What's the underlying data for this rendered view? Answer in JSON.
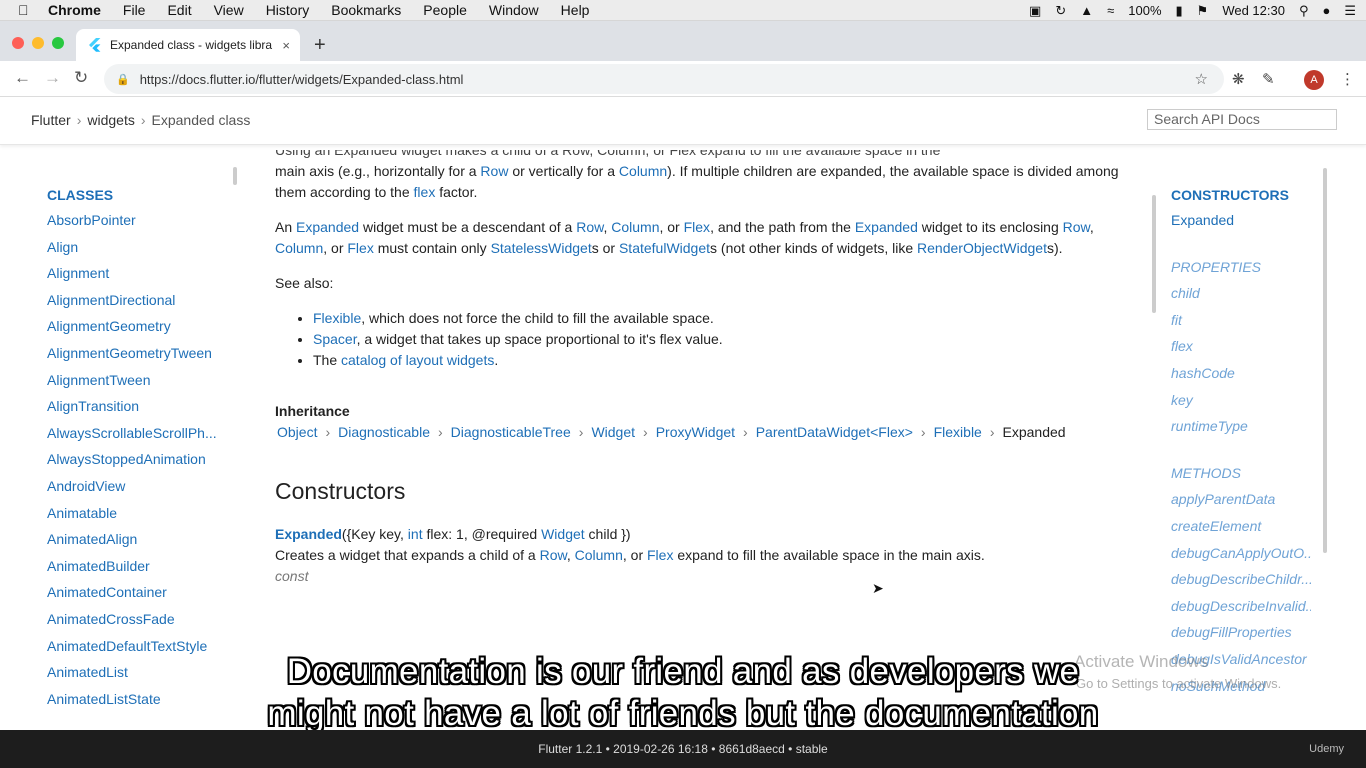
{
  "menubar": {
    "app": "Chrome",
    "items": [
      "File",
      "Edit",
      "View",
      "History",
      "Bookmarks",
      "People",
      "Window",
      "Help"
    ],
    "battery": "100%",
    "clock": "Wed 12:30"
  },
  "tab": {
    "title": "Expanded class - widgets libra",
    "close": "×"
  },
  "toolbar": {
    "url": "https://docs.flutter.io/flutter/widgets/Expanded-class.html",
    "avatar": "A"
  },
  "header": {
    "crumbs": [
      "Flutter",
      "widgets",
      "Expanded class"
    ],
    "search_placeholder": "Search API Docs"
  },
  "left_nav": {
    "heading": "CLASSES",
    "items": [
      "AbsorbPointer",
      "Align",
      "Alignment",
      "AlignmentDirectional",
      "AlignmentGeometry",
      "AlignmentGeometryTween",
      "AlignmentTween",
      "AlignTransition",
      "AlwaysScrollableScrollPh...",
      "AlwaysStoppedAnimation",
      "AndroidView",
      "Animatable",
      "AnimatedAlign",
      "AnimatedBuilder",
      "AnimatedContainer",
      "AnimatedCrossFade",
      "AnimatedDefaultTextStyle",
      "AnimatedList",
      "AnimatedListState"
    ]
  },
  "main": {
    "p1_cut": "Using an Expanded widget makes a child of a Row, Column, or Flex expand to fill the available space in the",
    "p1_a": "main axis (e.g., horizontally for a ",
    "p1_row": "Row",
    "p1_b": " or vertically for a ",
    "p1_col": "Column",
    "p1_c": "). If multiple children are expanded, the available space is divided among them according to the ",
    "p1_flex": "flex",
    "p1_d": " factor.",
    "p2_a": "An ",
    "p2_expanded": "Expanded",
    "p2_b": " widget must be a descendant of a ",
    "p2_row": "Row",
    "p2_sep1": ", ",
    "p2_col": "Column",
    "p2_sep2": ", or ",
    "p2_flex": "Flex",
    "p2_c": ", and the path from the ",
    "p2_expanded2": "Expanded",
    "p2_d": " widget to its enclosing ",
    "p2_row2": "Row",
    "p2_col2": "Column",
    "p2_flex2": "Flex",
    "p2_e": " must contain only ",
    "p2_stateless": "StatelessWidget",
    "p2_f": "s or ",
    "p2_stateful": "StatefulWidget",
    "p2_g": "s (not other kinds of widgets, like ",
    "p2_render": "RenderObjectWidget",
    "p2_h": "s).",
    "see_also": "See also:",
    "b1_link": "Flexible",
    "b1_text": ", which does not force the child to fill the available space.",
    "b2_link": "Spacer",
    "b2_text": ", a widget that takes up space proportional to it's flex value.",
    "b3_pre": "The ",
    "b3_link": "catalog of layout widgets",
    "b3_post": ".",
    "inheritance_title": "Inheritance",
    "inheritance": [
      "Object",
      "Diagnosticable",
      "DiagnosticableTree",
      "Widget",
      "ProxyWidget",
      "ParentDataWidget<Flex>",
      "Flexible"
    ],
    "inheritance_current": "Expanded",
    "constructors_title": "Constructors",
    "sig_name": "Expanded",
    "sig_a": "({Key key, ",
    "sig_int": "int",
    "sig_b": " flex: 1, @required ",
    "sig_widget": "Widget",
    "sig_c": " child })",
    "ctor_desc_a": "Creates a widget that expands a child of a ",
    "ctor_row": "Row",
    "ctor_col": "Column",
    "ctor_flex": "Flex",
    "ctor_desc_b": " expand to fill the available space in the main axis.",
    "const": "const"
  },
  "right_nav": {
    "heading": "CONSTRUCTORS",
    "ctor": "Expanded",
    "props_heading": "PROPERTIES",
    "props": [
      "child",
      "fit",
      "flex",
      "hashCode",
      "key",
      "runtimeType"
    ],
    "methods_heading": "METHODS",
    "methods": [
      "applyParentData",
      "createElement",
      "debugCanApplyOutO...",
      "debugDescribeChildr...",
      "debugDescribeInvalid...",
      "debugFillProperties",
      "debugIsValidAncestor",
      "noSuchMethod"
    ]
  },
  "footer": {
    "text": "Flutter 1.2.1 • 2019-02-26 16:18 • 8661d8aecd • stable",
    "brand": "Udemy"
  },
  "watermark": {
    "line1": "Activate Windows",
    "line2": "Go to Settings to activate Windows."
  },
  "captions": [
    "Documentation is our friend and as developers we",
    "might not have a lot of friends but the documentation"
  ]
}
